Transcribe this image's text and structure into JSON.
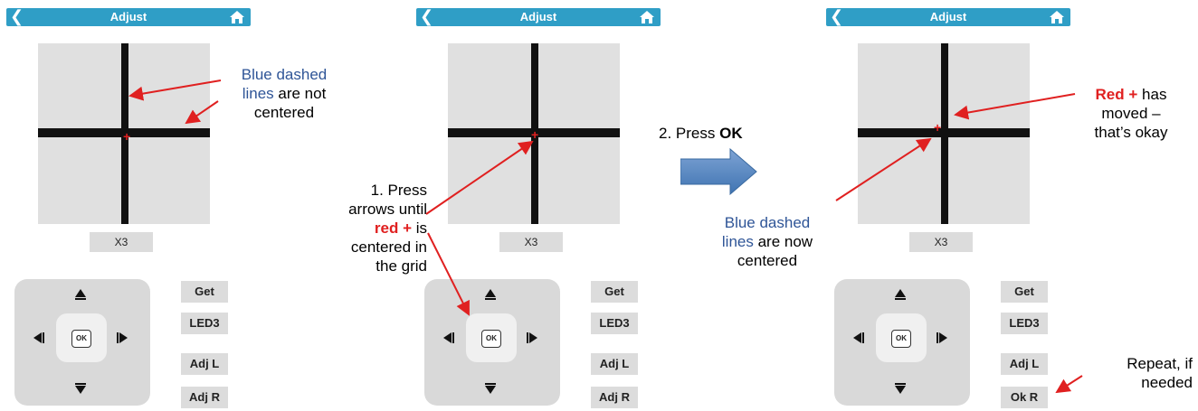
{
  "screen": {
    "title": "Adjust",
    "back_icon": "chevron-left-icon",
    "home_icon": "home-icon",
    "zoom_label": "X3",
    "ok_label": "OK",
    "buttons": [
      "Get",
      "LED3",
      "Adj L"
    ],
    "panel1_last_button": "Adj R",
    "panel2_last_button": "Adj R",
    "panel3_last_button": "Ok R"
  },
  "colors": {
    "header": "#2f9ec6",
    "grid": "#e0e0e0",
    "annotation_blue": "#2f5597",
    "annotation_red": "#e02020",
    "step_arrow": "#3f74b2"
  },
  "annotations": {
    "panel1": {
      "blue": "Blue dashed",
      "blue2": "lines",
      "rest": " are not",
      "rest2": "centered"
    },
    "step1": {
      "line1": "1. Press",
      "line2": "arrows until",
      "red": "red +",
      "line3b": " is",
      "line4": "centered in",
      "line5": "the grid"
    },
    "step2": {
      "text": "2. Press ",
      "bold": "OK"
    },
    "panel3_left": {
      "blue1": "Blue dashed",
      "blue2": "lines",
      "rest1": " are now",
      "rest2": "centered"
    },
    "panel3_right": {
      "red": "Red +",
      "rest1": " has",
      "line2": "moved –",
      "line3": "that’s okay"
    },
    "repeat": {
      "line1": "Repeat, if",
      "line2": "needed"
    }
  }
}
